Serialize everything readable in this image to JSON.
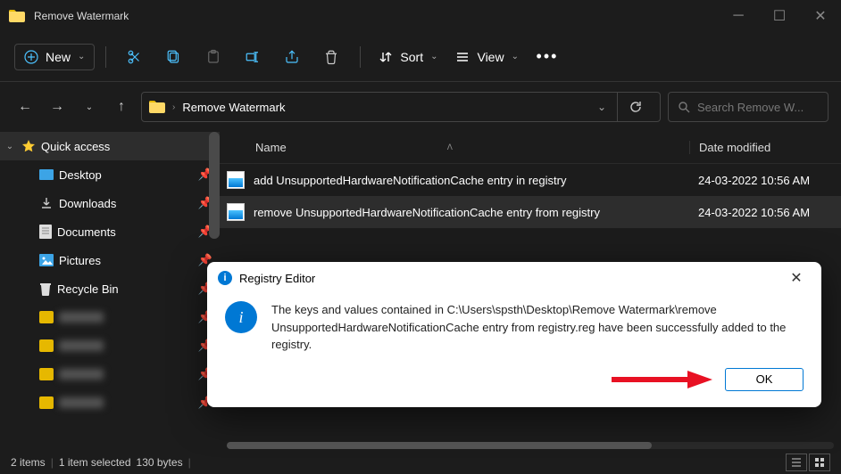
{
  "titlebar": {
    "title": "Remove Watermark"
  },
  "toolbar": {
    "new_label": "New",
    "sort_label": "Sort",
    "view_label": "View"
  },
  "nav": {
    "crumb": "Remove Watermark",
    "search_placeholder": "Search Remove W..."
  },
  "columns": {
    "name": "Name",
    "date": "Date modified"
  },
  "sidebar": {
    "quick_access": "Quick access",
    "items": [
      {
        "label": "Desktop"
      },
      {
        "label": "Downloads"
      },
      {
        "label": "Documents"
      },
      {
        "label": "Pictures"
      },
      {
        "label": "Recycle Bin"
      }
    ]
  },
  "files": [
    {
      "name": "add UnsupportedHardwareNotificationCache entry in registry",
      "date": "24-03-2022 10:56 AM"
    },
    {
      "name": "remove UnsupportedHardwareNotificationCache entry from registry",
      "date": "24-03-2022 10:56 AM"
    }
  ],
  "statusbar": {
    "items": "2 items",
    "selected": "1 item selected",
    "size": "130 bytes"
  },
  "dialog": {
    "title": "Registry Editor",
    "message": "The keys and values contained in C:\\Users\\spsth\\Desktop\\Remove Watermark\\remove UnsupportedHardwareNotificationCache entry from registry.reg have been successfully added to the registry.",
    "ok_label": "OK"
  }
}
